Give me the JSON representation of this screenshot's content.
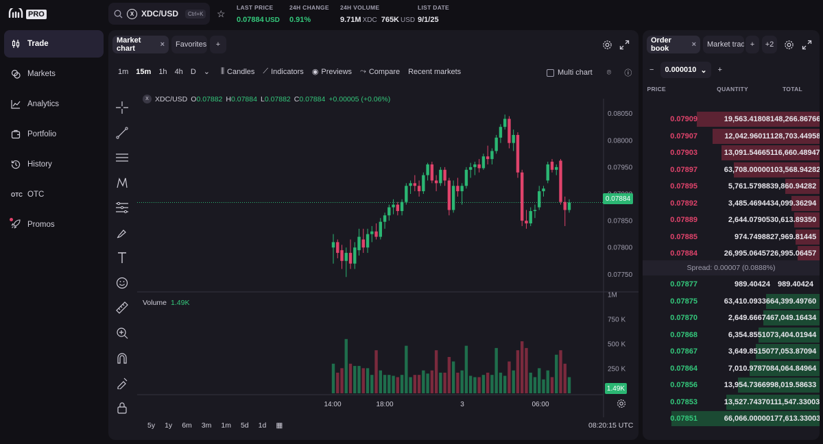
{
  "app": {
    "brand": "PRO"
  },
  "sidebar": {
    "items": [
      {
        "label": "Trade",
        "icon": "candles-icon",
        "active": true
      },
      {
        "label": "Markets",
        "icon": "markets-icon"
      },
      {
        "label": "Analytics",
        "icon": "analytics-icon"
      },
      {
        "label": "Portfolio",
        "icon": "portfolio-icon"
      },
      {
        "label": "History",
        "icon": "history-icon"
      },
      {
        "label": "OTC",
        "icon": "otc-icon",
        "icon_text": "OTC"
      },
      {
        "label": "Promos",
        "icon": "rocket-icon"
      }
    ]
  },
  "header": {
    "pair": "XDC/USD",
    "coin_glyph": "X",
    "shortcut": "Ctrl+K",
    "stats": [
      {
        "label": "LAST PRICE",
        "value": "0.07884",
        "unit": "USD"
      },
      {
        "label": "24H CHANGE",
        "value": "0.91%"
      },
      {
        "label": "24H VOLUME",
        "value": "9.71M",
        "unit": "XDC",
        "value2": "765K",
        "unit2": "USD"
      },
      {
        "label": "LIST DATE",
        "value": "9/1/25"
      }
    ]
  },
  "chart_panel": {
    "tabs": [
      {
        "label": "Market chart",
        "close": "×"
      },
      {
        "label": "Favorites"
      }
    ],
    "add_tab": "+",
    "timeframes": [
      "1m",
      "15m",
      "1h",
      "4h",
      "D"
    ],
    "active_timeframe": "15m",
    "toolbar": {
      "candles": "Candles",
      "indicators": "Indicators",
      "previews": "Previews",
      "compare": "Compare",
      "recent": "Recent markets",
      "multi_chart": "Multi chart"
    },
    "legend": {
      "symbol": "XDC/USD",
      "o_label": "O",
      "open": "0.07882",
      "h_label": "H",
      "high": "0.07884",
      "l_label": "L",
      "low": "0.07882",
      "c_label": "C",
      "close": "0.07884",
      "change": "+0.00005 (+0.06%)"
    },
    "volume_legend": {
      "label": "Volume",
      "value": "1.49K"
    },
    "price_tag": "0.07884",
    "volume_tag": "1.49K",
    "range_buttons": [
      "5y",
      "1y",
      "6m",
      "3m",
      "1m",
      "5d",
      "1d"
    ],
    "clock": "08:20:15 UTC"
  },
  "chart_data": [
    {
      "type": "candlestick",
      "title": "",
      "price_axis_ticks": [
        "0.08050",
        "0.08000",
        "0.07950",
        "0.07900",
        "0.07850",
        "0.07800",
        "0.07750"
      ],
      "ylim": [
        0.0773,
        0.0807
      ],
      "time_axis_ticks": [
        "14:00",
        "18:00",
        "3",
        "06:00"
      ],
      "last_price_line": 0.07884,
      "candles": [
        [
          0.078,
          0.07825,
          0.0777,
          0.0781
        ],
        [
          0.0781,
          0.07815,
          0.0778,
          0.0779
        ],
        [
          0.07795,
          0.07805,
          0.0776,
          0.07775
        ],
        [
          0.07775,
          0.078,
          0.07745,
          0.0779
        ],
        [
          0.0779,
          0.07815,
          0.0776,
          0.0777
        ],
        [
          0.0777,
          0.0781,
          0.0776,
          0.078
        ],
        [
          0.07795,
          0.07835,
          0.07785,
          0.0782
        ],
        [
          0.07815,
          0.07835,
          0.0779,
          0.078
        ],
        [
          0.078,
          0.07835,
          0.0779,
          0.07825
        ],
        [
          0.07825,
          0.0784,
          0.0781,
          0.0783
        ],
        [
          0.0783,
          0.07845,
          0.07815,
          0.0782
        ],
        [
          0.0782,
          0.07855,
          0.07815,
          0.07848
        ],
        [
          0.07848,
          0.07865,
          0.07835,
          0.0786
        ],
        [
          0.0786,
          0.0788,
          0.0785,
          0.07875
        ],
        [
          0.07875,
          0.0789,
          0.07862,
          0.0788
        ],
        [
          0.0788,
          0.07885,
          0.0786,
          0.07868
        ],
        [
          0.07868,
          0.0789,
          0.0786,
          0.07885
        ],
        [
          0.07885,
          0.0792,
          0.0788,
          0.07915
        ],
        [
          0.07915,
          0.07925,
          0.079,
          0.0792
        ],
        [
          0.0792,
          0.07935,
          0.07905,
          0.07915
        ],
        [
          0.07915,
          0.07925,
          0.07895,
          0.07905
        ],
        [
          0.07905,
          0.0794,
          0.079,
          0.07935
        ],
        [
          0.07935,
          0.07958,
          0.07925,
          0.07955
        ],
        [
          0.07955,
          0.0796,
          0.0792,
          0.07925
        ],
        [
          0.07925,
          0.07935,
          0.07905,
          0.0792
        ],
        [
          0.0792,
          0.0795,
          0.07915,
          0.07945
        ],
        [
          0.07945,
          0.0795,
          0.07915,
          0.07925
        ],
        [
          0.07925,
          0.0793,
          0.0786,
          0.0787
        ],
        [
          0.0787,
          0.07925,
          0.07865,
          0.07915
        ],
        [
          0.07915,
          0.0793,
          0.07895,
          0.07905
        ],
        [
          0.07905,
          0.0792,
          0.0788,
          0.07915
        ],
        [
          0.07915,
          0.0795,
          0.0791,
          0.07945
        ],
        [
          0.07945,
          0.07958,
          0.0793,
          0.0795
        ],
        [
          0.0795,
          0.0796,
          0.07935,
          0.07955
        ],
        [
          0.07955,
          0.07965,
          0.0794,
          0.07948
        ],
        [
          0.07948,
          0.07975,
          0.07945,
          0.0797
        ],
        [
          0.0797,
          0.0799,
          0.07955,
          0.07965
        ],
        [
          0.07965,
          0.07985,
          0.07955,
          0.0798
        ],
        [
          0.0798,
          0.0801,
          0.07975,
          0.08005
        ],
        [
          0.08005,
          0.0803,
          0.07995,
          0.08025
        ],
        [
          0.08025,
          0.08048,
          0.0802,
          0.0804
        ],
        [
          0.0804,
          0.08045,
          0.07985,
          0.07995
        ],
        [
          0.07995,
          0.0802,
          0.0798,
          0.0801
        ],
        [
          0.0801,
          0.08015,
          0.0793,
          0.0794
        ],
        [
          0.0794,
          0.07945,
          0.0784,
          0.0785
        ],
        [
          0.0785,
          0.0787,
          0.07835,
          0.07845
        ],
        [
          0.07845,
          0.07875,
          0.0784,
          0.07868
        ],
        [
          0.07868,
          0.0788,
          0.07855,
          0.0787
        ],
        [
          0.07875,
          0.07915,
          0.0787,
          0.07905
        ],
        [
          0.07905,
          0.07915,
          0.07895,
          0.0791
        ],
        [
          0.07925,
          0.0796,
          0.0792,
          0.07955
        ],
        [
          0.0796,
          0.07965,
          0.0794,
          0.07945
        ],
        [
          0.07945,
          0.07955,
          0.07935,
          0.0795
        ],
        [
          0.07962,
          0.07965,
          0.0788,
          0.07885
        ],
        [
          0.07885,
          0.07895,
          0.0784,
          0.0787
        ],
        [
          0.0787,
          0.0789,
          0.07865,
          0.07884
        ]
      ],
      "volume_axis_ticks": [
        "1M",
        "750 K",
        "500 K",
        "250 K"
      ]
    }
  ],
  "orderbook": {
    "tabs": [
      {
        "label": "Order book",
        "close": "×"
      },
      {
        "label": "Market trad"
      }
    ],
    "add": "+",
    "more": "+2",
    "tick_minus": "−",
    "tick": "0.000010",
    "tick_plus": "+",
    "headers": {
      "price": "PRICE",
      "quantity": "QUANTITY",
      "total": "TOTAL"
    },
    "asks": [
      {
        "price": "0.07909",
        "qty": "19,563.41808",
        "total": "148,266.86766",
        "depth": 0.83
      },
      {
        "price": "0.07907",
        "qty": "12,042.96011",
        "total": "128,703.44958",
        "depth": 0.72
      },
      {
        "price": "0.07903",
        "qty": "13,091.54665",
        "total": "116,660.48947",
        "depth": 0.66
      },
      {
        "price": "0.07897",
        "qty": "63,708.00000",
        "total": "103,568.94282",
        "depth": 0.58
      },
      {
        "price": "0.07895",
        "qty": "5,761.57988",
        "total": "39,860.94282",
        "depth": 0.23
      },
      {
        "price": "0.07892",
        "qty": "3,485.46944",
        "total": "34,099.36294",
        "depth": 0.19
      },
      {
        "price": "0.07889",
        "qty": "2,644.07905",
        "total": "30,613.89350",
        "depth": 0.17
      },
      {
        "price": "0.07885",
        "qty": "974.74988",
        "total": "27,969.81445",
        "depth": 0.16
      },
      {
        "price": "0.07884",
        "qty": "26,995.06457",
        "total": "26,995.06457",
        "depth": 0.15
      }
    ],
    "spread": "Spread: 0.00007 (0.0888%)",
    "bids": [
      {
        "price": "0.07877",
        "qty": "989.40424",
        "total": "989.40424",
        "depth": 0.0
      },
      {
        "price": "0.07875",
        "qty": "63,410.09336",
        "total": "64,399.49760",
        "depth": 0.36
      },
      {
        "price": "0.07870",
        "qty": "2,649.66674",
        "total": "67,049.16434",
        "depth": 0.38
      },
      {
        "price": "0.07868",
        "qty": "6,354.85510",
        "total": "73,404.01944",
        "depth": 0.41
      },
      {
        "price": "0.07867",
        "qty": "3,649.85150",
        "total": "77,053.87094",
        "depth": 0.43
      },
      {
        "price": "0.07864",
        "qty": "7,010.97870",
        "total": "84,064.84964",
        "depth": 0.47
      },
      {
        "price": "0.07856",
        "qty": "13,954.73669",
        "total": "98,019.58633",
        "depth": 0.55
      },
      {
        "price": "0.07853",
        "qty": "13,527.74370",
        "total": "111,547.33003",
        "depth": 0.63
      },
      {
        "price": "0.07851",
        "qty": "66,066.00000",
        "total": "177,613.33003",
        "depth": 1.0
      }
    ]
  },
  "colors": {
    "up": "#2bb673",
    "down": "#e0436b",
    "accent": "#7b5cf5",
    "panel": "#1a1921",
    "bg": "#111015"
  }
}
